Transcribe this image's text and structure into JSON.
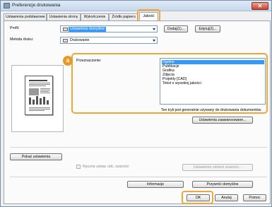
{
  "window": {
    "title": "Preferencje drukowania",
    "close_label": "✕"
  },
  "tabs": [
    {
      "label": "Ustawienia podstawowe"
    },
    {
      "label": "Ustawienia strony"
    },
    {
      "label": "Wykończenie"
    },
    {
      "label": "Źródło papieru"
    },
    {
      "label": "Jakość"
    }
  ],
  "profile": {
    "label": "Profil:",
    "value": "Ustawienia domyślne",
    "add_button": "Dodaj(1)...",
    "edit_button": "Edytuj(2)..."
  },
  "print_method": {
    "label": "Metoda druku:",
    "value": "Drukowanie"
  },
  "badge": "a",
  "purpose": {
    "label": "Przeznaczenie:",
    "options": [
      "Ogólne",
      "Publikacje",
      "Grafika",
      "Zdjęcia",
      "Projekty [CAD]",
      "Tekst o wysokiej jakości"
    ],
    "selected_index": 0,
    "description": "Ten tryb jest generalnie używany do drukowania dokumentów."
  },
  "advanced_button": "Ustawienia zaawansowane...",
  "show_settings_button": "Pokaż ustawienia",
  "manual_gray": {
    "label": "Ręczne ustaw. odc. szarości",
    "checked": false
  },
  "gray_settings_button": "Ustawienie odcieni szarości...",
  "info_button": "Informacje",
  "restore_button": "Przywróć domyślne",
  "footer": {
    "ok": "OK",
    "cancel": "Anuluj",
    "help": "Pomoc"
  }
}
